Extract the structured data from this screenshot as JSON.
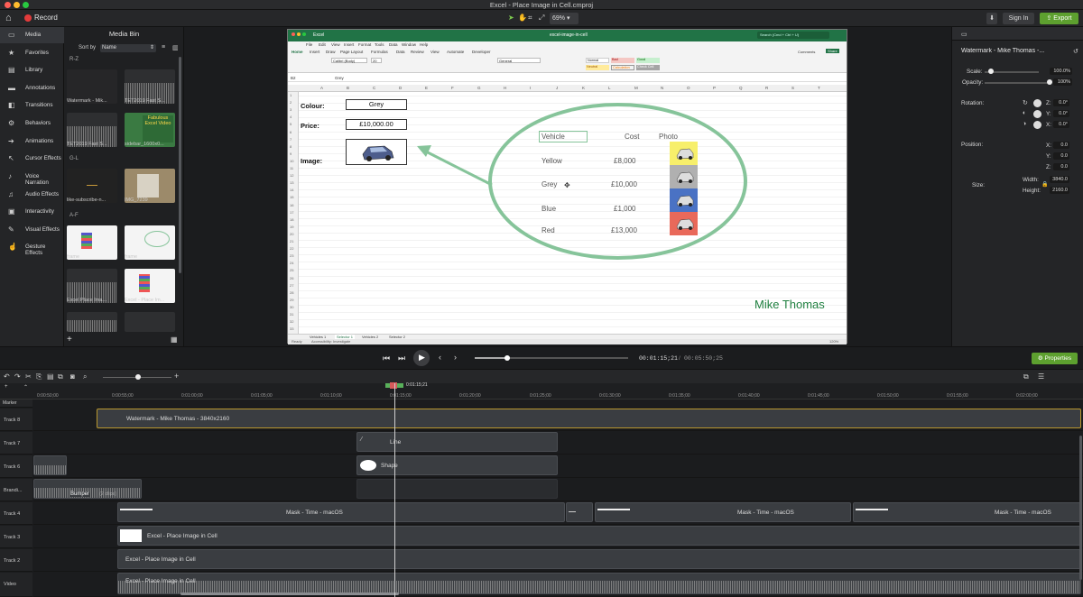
{
  "window": {
    "title": "Excel - Place Image in Cell.cmproj"
  },
  "toolbar": {
    "record": "Record",
    "zoom": "69%",
    "sign_in": "Sign In",
    "export": "Export",
    "accent": "#5da02f"
  },
  "tools": [
    {
      "label": "Media",
      "icon": "media-icon"
    },
    {
      "label": "Favorites",
      "icon": "star-icon"
    },
    {
      "label": "Library",
      "icon": "library-icon"
    },
    {
      "label": "Annotations",
      "icon": "annotation-icon"
    },
    {
      "label": "Transitions",
      "icon": "transition-icon"
    },
    {
      "label": "Behaviors",
      "icon": "behavior-icon"
    },
    {
      "label": "Animations",
      "icon": "animation-icon"
    },
    {
      "label": "Cursor Effects",
      "icon": "cursor-icon"
    },
    {
      "label": "Voice Narration",
      "icon": "mic-icon"
    },
    {
      "label": "Audio Effects",
      "icon": "audio-icon"
    },
    {
      "label": "Interactivity",
      "icon": "interactivity-icon"
    },
    {
      "label": "Visual Effects",
      "icon": "visual-effects-icon"
    },
    {
      "label": "Gesture Effects",
      "icon": "gesture-icon"
    }
  ],
  "media_bin": {
    "title": "Media Bin",
    "sort_by": "Sort by",
    "sort_value": "Name",
    "sections": [
      "R-Z",
      "G-L",
      "A-F"
    ],
    "items": [
      {
        "label": "Watermark - Mik..."
      },
      {
        "label": "TET2019 Fast S..."
      },
      {
        "label": "TET2019 Fast S..."
      },
      {
        "label": "sidebar_1600x0..."
      },
      {
        "label": "like-subscribe-n..."
      },
      {
        "label": "IMG_7239"
      },
      {
        "label": "frame"
      },
      {
        "label": "frame"
      },
      {
        "label": "Excel Place Ima..."
      },
      {
        "label": "Excel - Place Im..."
      }
    ]
  },
  "excel": {
    "app": "Excel",
    "menu": [
      "File",
      "Edit",
      "View",
      "Insert",
      "Format",
      "Tools",
      "Data",
      "Window",
      "Help"
    ],
    "doc_title": "excel-image-in-cell",
    "search": "Search (Cmd + Ctrl + U)",
    "ribbon_tabs": [
      "Home",
      "Insert",
      "Draw",
      "Page Layout",
      "Formulas",
      "Data",
      "Review",
      "View",
      "Automate",
      "Developer"
    ],
    "comments": "Comments",
    "share": "Share",
    "font": "Calibri (Body)",
    "font_size": "20",
    "number_format": "General",
    "styles": [
      "Normal",
      "Bad",
      "Good",
      "Neutral",
      "Calculation",
      "Check Cell"
    ],
    "name_box": "B2",
    "formula": "Grey",
    "columns": [
      "A",
      "B",
      "C",
      "D",
      "E",
      "F",
      "G",
      "H",
      "I",
      "J",
      "K",
      "L",
      "M",
      "N",
      "O",
      "P",
      "Q",
      "R",
      "S",
      "T"
    ],
    "colour_label": "Colour:",
    "colour_value": "Grey",
    "price_label": "Price:",
    "price_value": "£10,000.00",
    "image_label": "Image:",
    "sheet_tabs": [
      "Vehicles 1",
      "Selector 1",
      "Vehicles 2",
      "Selector 2"
    ],
    "status": "Ready",
    "accessibility": "Accessibility: Investigate",
    "zoom": "120%",
    "table_headers": [
      "Vehicle",
      "Cost",
      "Photo"
    ],
    "table_rows": [
      {
        "vehicle": "Yellow",
        "cost": "£8,000",
        "color": "#f7ef6b"
      },
      {
        "vehicle": "Grey",
        "cost": "£10,000",
        "color": "#b0b0b0"
      },
      {
        "vehicle": "Blue",
        "cost": "£1,000",
        "color": "#4a72c4"
      },
      {
        "vehicle": "Red",
        "cost": "£13,000",
        "color": "#e9695a"
      }
    ],
    "watermark": "Mike Thomas"
  },
  "properties": {
    "title": "Watermark - Mike Thomas -...",
    "scale_label": "Scale:",
    "scale": "100.0%",
    "scale_level": 0.12,
    "opacity_label": "Opacity:",
    "opacity": "100%",
    "opacity_level": 1.0,
    "rotation_label": "Rotation:",
    "rot_z": "0.0°",
    "rot_y": "0.0°",
    "rot_x": "0.0°",
    "position_label": "Position:",
    "pos_x": "0.0",
    "pos_y": "0.0",
    "pos_z": "0.0",
    "size_label": "Size:",
    "width_label": "Width:",
    "width": "3840.0",
    "height_label": "Height:",
    "height": "2160.0",
    "properties_button": "Properties"
  },
  "playback": {
    "current": "00:01:15;21",
    "total": "00:05:50;25",
    "progress": 0.21
  },
  "timeline": {
    "playhead_label": "0:01:15;21",
    "marker": "Marker",
    "ticks": [
      "0:00:50;00",
      "0:00:55;00",
      "0:01:00;00",
      "0:01:05;00",
      "0:01:10;00",
      "0:01:15;00",
      "0:01:20;00",
      "0:01:25;00",
      "0:01:30;00",
      "0:01:35;00",
      "0:01:40;00",
      "0:01:45;00",
      "0:01:50;00",
      "0:01:55;00",
      "0:02:00;00"
    ],
    "tracks": [
      {
        "name": "Track 8",
        "clips": [
          "Watermark - Mike Thomas - 3840x2160"
        ]
      },
      {
        "name": "Track 7",
        "clips": [
          "Line"
        ]
      },
      {
        "name": "Track 6",
        "clips": [
          "Shape"
        ]
      },
      {
        "name": "Brandi...",
        "clips": [
          "Bumper",
          "(2 clips)"
        ]
      },
      {
        "name": "Track 4",
        "clips": [
          "Mask - Time - macOS",
          "Mask - Time - macOS",
          "Mask - Time - macOS"
        ]
      },
      {
        "name": "Track 3",
        "clips": [
          "Excel - Place Image in Cell"
        ]
      },
      {
        "name": "Track 2",
        "clips": [
          "Excel - Place Image in Cell"
        ]
      },
      {
        "name": "Video",
        "clips": [
          "Excel - Place Image in Cell"
        ]
      }
    ]
  }
}
